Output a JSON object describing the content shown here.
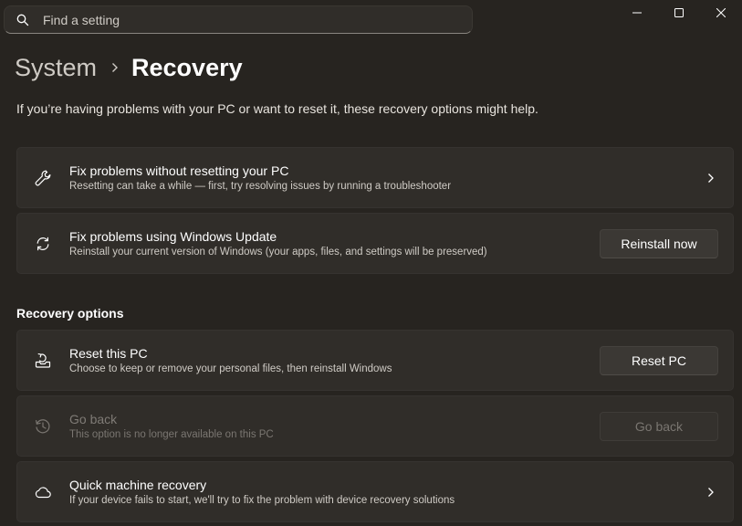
{
  "search": {
    "placeholder": "Find a setting",
    "icon": "search-icon"
  },
  "window_controls": {
    "minimize": "minimize-icon",
    "maximize": "maximize-icon",
    "close": "close-icon"
  },
  "breadcrumb": {
    "parent": "System",
    "current": "Recovery"
  },
  "description": "If you’re having problems with your PC or want to reset it, these recovery options might help.",
  "cards_top": [
    {
      "icon": "wrench-icon",
      "title": "Fix problems without resetting your PC",
      "subtitle": "Resetting can take a while — first, try resolving issues by running a troubleshooter"
    },
    {
      "icon": "refresh-icon",
      "title": "Fix problems using Windows Update",
      "subtitle": "Reinstall your current version of Windows (your apps, files, and settings will be preserved)",
      "button": "Reinstall now"
    }
  ],
  "recovery_options": {
    "header": "Recovery options",
    "items": [
      {
        "icon": "reset-pc-icon",
        "title": "Reset this PC",
        "subtitle": "Choose to keep or remove your personal files, then reinstall Windows",
        "button": "Reset PC"
      },
      {
        "icon": "history-icon",
        "title": "Go back",
        "subtitle": "This option is no longer available on this PC",
        "button": "Go back",
        "disabled": true
      },
      {
        "icon": "cloud-icon",
        "title": "Quick machine recovery",
        "subtitle": "If your device fails to start, we'll try to fix the problem with device recovery solutions"
      }
    ]
  },
  "colors": {
    "background": "#272420",
    "card": "#302d29",
    "text_primary": "#ffffff",
    "text_secondary": "#cfcbc5",
    "text_disabled": "#7a7671"
  }
}
